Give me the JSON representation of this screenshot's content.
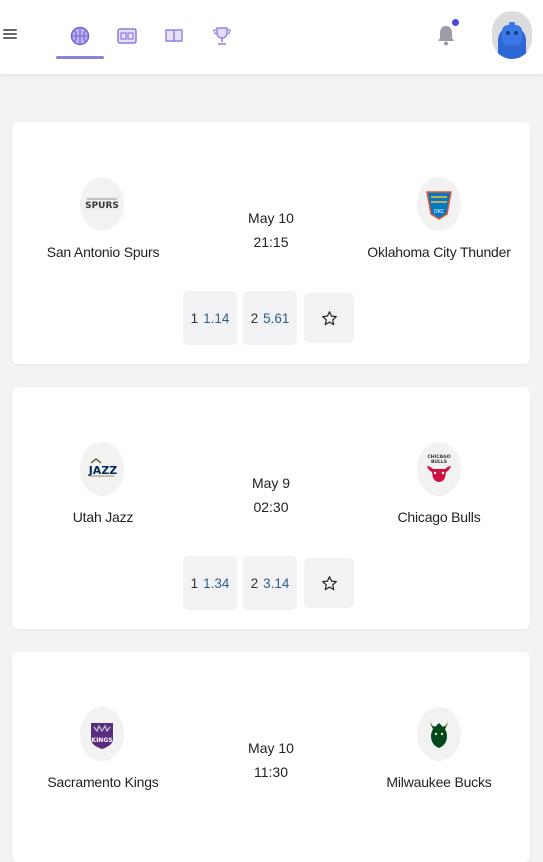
{
  "header": {
    "nav_tabs": [
      {
        "name": "basketball",
        "active": true
      },
      {
        "name": "scoreboard",
        "active": false
      },
      {
        "name": "book",
        "active": false
      },
      {
        "name": "trophy",
        "active": false
      }
    ],
    "notification_has_unread": true,
    "accent_color": "#8a84d8"
  },
  "matches": [
    {
      "home": {
        "name": "San Antonio Spurs",
        "logo": "spurs-logo"
      },
      "away": {
        "name": "Oklahoma City Thunder",
        "logo": "thunder-logo"
      },
      "date": "May 10",
      "time": "21:15",
      "odds": [
        {
          "label": "1",
          "value": "1.14"
        },
        {
          "label": "2",
          "value": "5.61"
        }
      ]
    },
    {
      "home": {
        "name": "Utah Jazz",
        "logo": "jazz-logo"
      },
      "away": {
        "name": "Chicago Bulls",
        "logo": "bulls-logo"
      },
      "date": "May 9",
      "time": "02:30",
      "odds": [
        {
          "label": "1",
          "value": "1.34"
        },
        {
          "label": "2",
          "value": "3.14"
        }
      ]
    },
    {
      "home": {
        "name": "Sacramento Kings",
        "logo": "kings-logo"
      },
      "away": {
        "name": "Milwaukee Bucks",
        "logo": "bucks-logo"
      },
      "date": "May 10",
      "time": "11:30",
      "odds": []
    }
  ]
}
